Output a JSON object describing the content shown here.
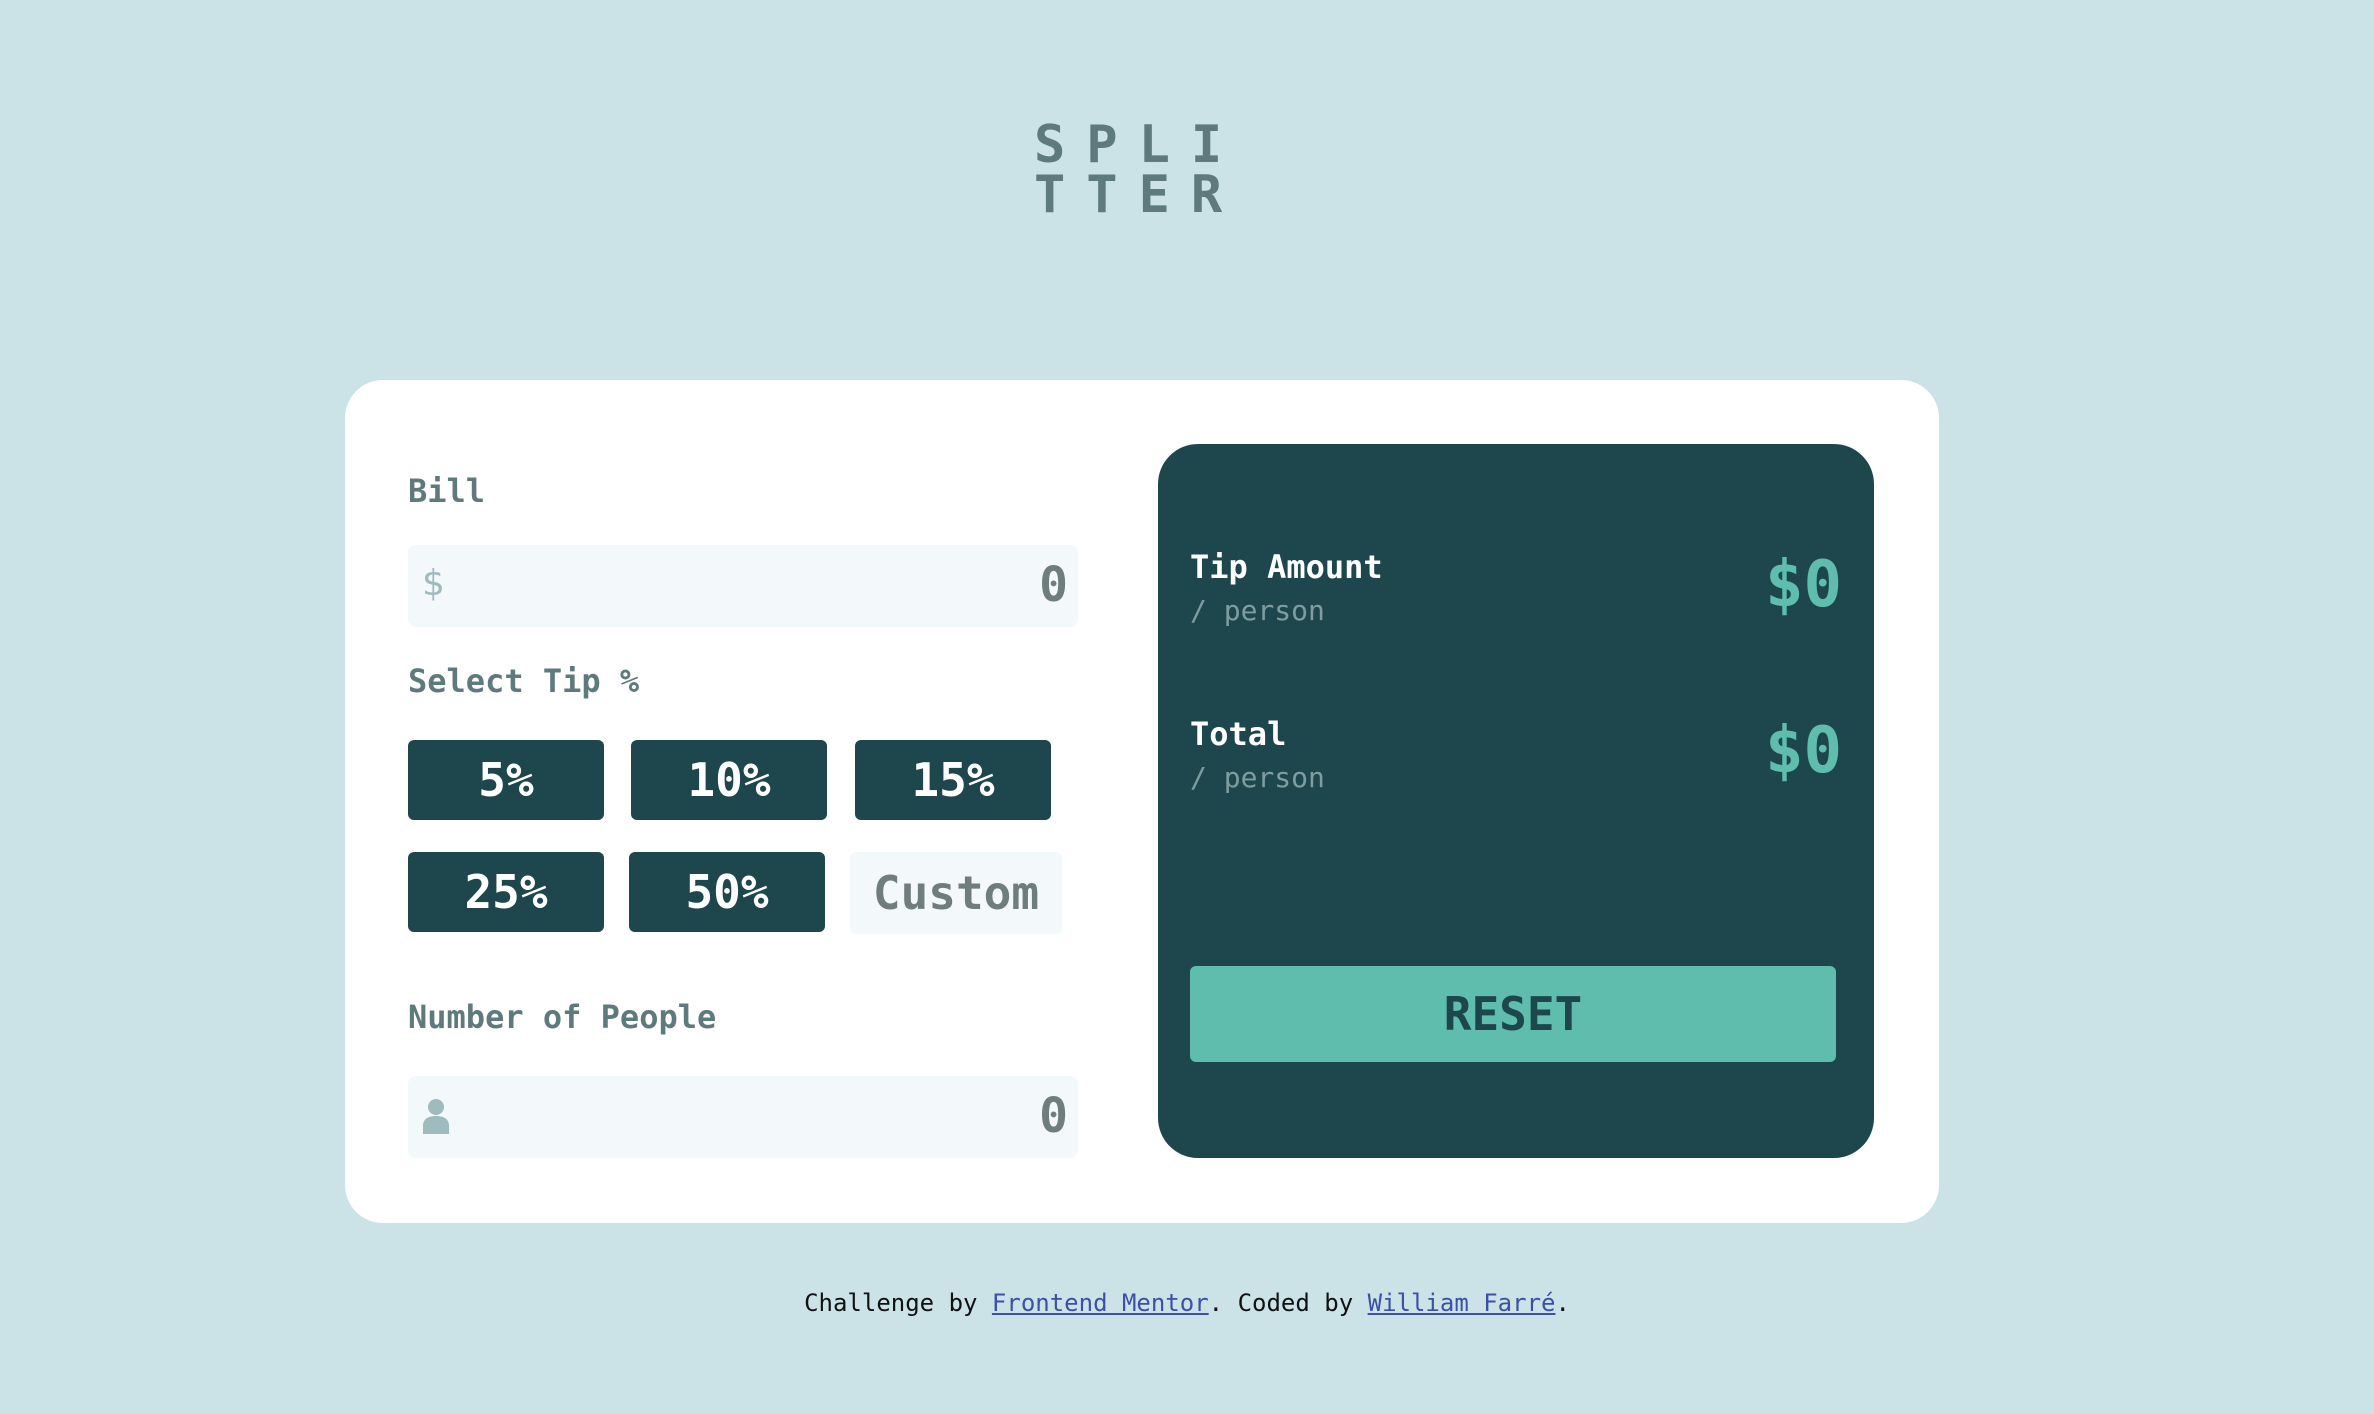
{
  "logo": {
    "line1": "SPLI",
    "line2": "TTER"
  },
  "form": {
    "bill_label": "Bill",
    "bill_icon": "dollar-icon",
    "bill_icon_glyph": "$",
    "bill_value": "0",
    "tip_label": "Select Tip %",
    "tips": [
      "5%",
      "10%",
      "15%",
      "25%",
      "50%"
    ],
    "custom_placeholder": "Custom",
    "people_label": "Number of People",
    "people_icon": "person-icon",
    "people_value": "0"
  },
  "results": {
    "tip_title": "Tip Amount",
    "tip_sub": "/ person",
    "tip_value": "$0",
    "total_title": "Total",
    "total_sub": "/ person",
    "total_value": "$0",
    "reset_label": "RESET"
  },
  "footer": {
    "prefix": "Challenge by ",
    "link1": "Frontend Mentor",
    "middle": ". Coded by ",
    "link2": "William Farré",
    "suffix": "."
  },
  "colors": {
    "background": "#cbe3e7",
    "dark_cyan": "#1e474d",
    "accent": "#5ebdac",
    "label_gray": "#5e7a7d",
    "input_bg": "#f3f8fb"
  }
}
